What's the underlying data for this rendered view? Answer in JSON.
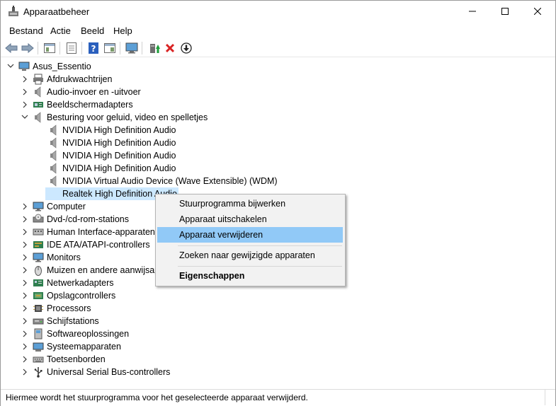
{
  "window": {
    "title": "Apparaatbeheer"
  },
  "menu": [
    "Bestand",
    "Actie",
    "Beeld",
    "Help"
  ],
  "tree": {
    "root": "Asus_Essentio",
    "categories": [
      {
        "label": "Afdrukwachtrijen",
        "icon": "printer-icon"
      },
      {
        "label": "Audio-invoer en -uitvoer",
        "icon": "speaker-icon"
      },
      {
        "label": "Beeldschermadapters",
        "icon": "display-adapter-icon"
      },
      {
        "label": "Besturing voor geluid, video en spelletjes",
        "icon": "speaker-icon"
      },
      {
        "label": "Computer",
        "icon": "monitor-icon"
      },
      {
        "label": "Dvd-/cd-rom-stations",
        "icon": "dvd-drive-icon"
      },
      {
        "label": "Human Interface-apparaten",
        "icon": "hid-icon"
      },
      {
        "label": "IDE ATA/ATAPI-controllers",
        "icon": "ide-controller-icon"
      },
      {
        "label": "Monitors",
        "icon": "monitor-icon"
      },
      {
        "label": "Muizen en andere aanwijsapparaten",
        "icon": "mouse-icon"
      },
      {
        "label": "Netwerkadapters",
        "icon": "network-icon"
      },
      {
        "label": "Opslagcontrollers",
        "icon": "storage-icon"
      },
      {
        "label": "Processors",
        "icon": "cpu-icon"
      },
      {
        "label": "Schijfstations",
        "icon": "disk-drive-icon"
      },
      {
        "label": "Softwareoplossingen",
        "icon": "software-icon"
      },
      {
        "label": "Systeemapparaten",
        "icon": "system-device-icon"
      },
      {
        "label": "Toetsenborden",
        "icon": "keyboard-icon"
      },
      {
        "label": "Universal Serial Bus-controllers",
        "icon": "usb-icon"
      }
    ],
    "sound_devices": [
      "NVIDIA High Definition Audio",
      "NVIDIA High Definition Audio",
      "NVIDIA High Definition Audio",
      "NVIDIA High Definition Audio",
      "NVIDIA Virtual Audio Device (Wave Extensible) (WDM)",
      "Realtek High Definition Audio"
    ]
  },
  "context_menu": {
    "items": [
      "Stuurprogramma bijwerken",
      "Apparaat uitschakelen",
      "Apparaat verwijderen",
      "Zoeken naar gewijzigde apparaten",
      "Eigenschappen"
    ],
    "highlighted_item": "Apparaat verwijderen"
  },
  "status": "Hiermee wordt het stuurprogramma voor het geselecteerde apparaat verwijderd.",
  "colors": {
    "selection": "#cce8ff",
    "menu_highlight": "#91c9f7",
    "delete_red": "#d92323",
    "help_blue": "#2a5fbd"
  }
}
